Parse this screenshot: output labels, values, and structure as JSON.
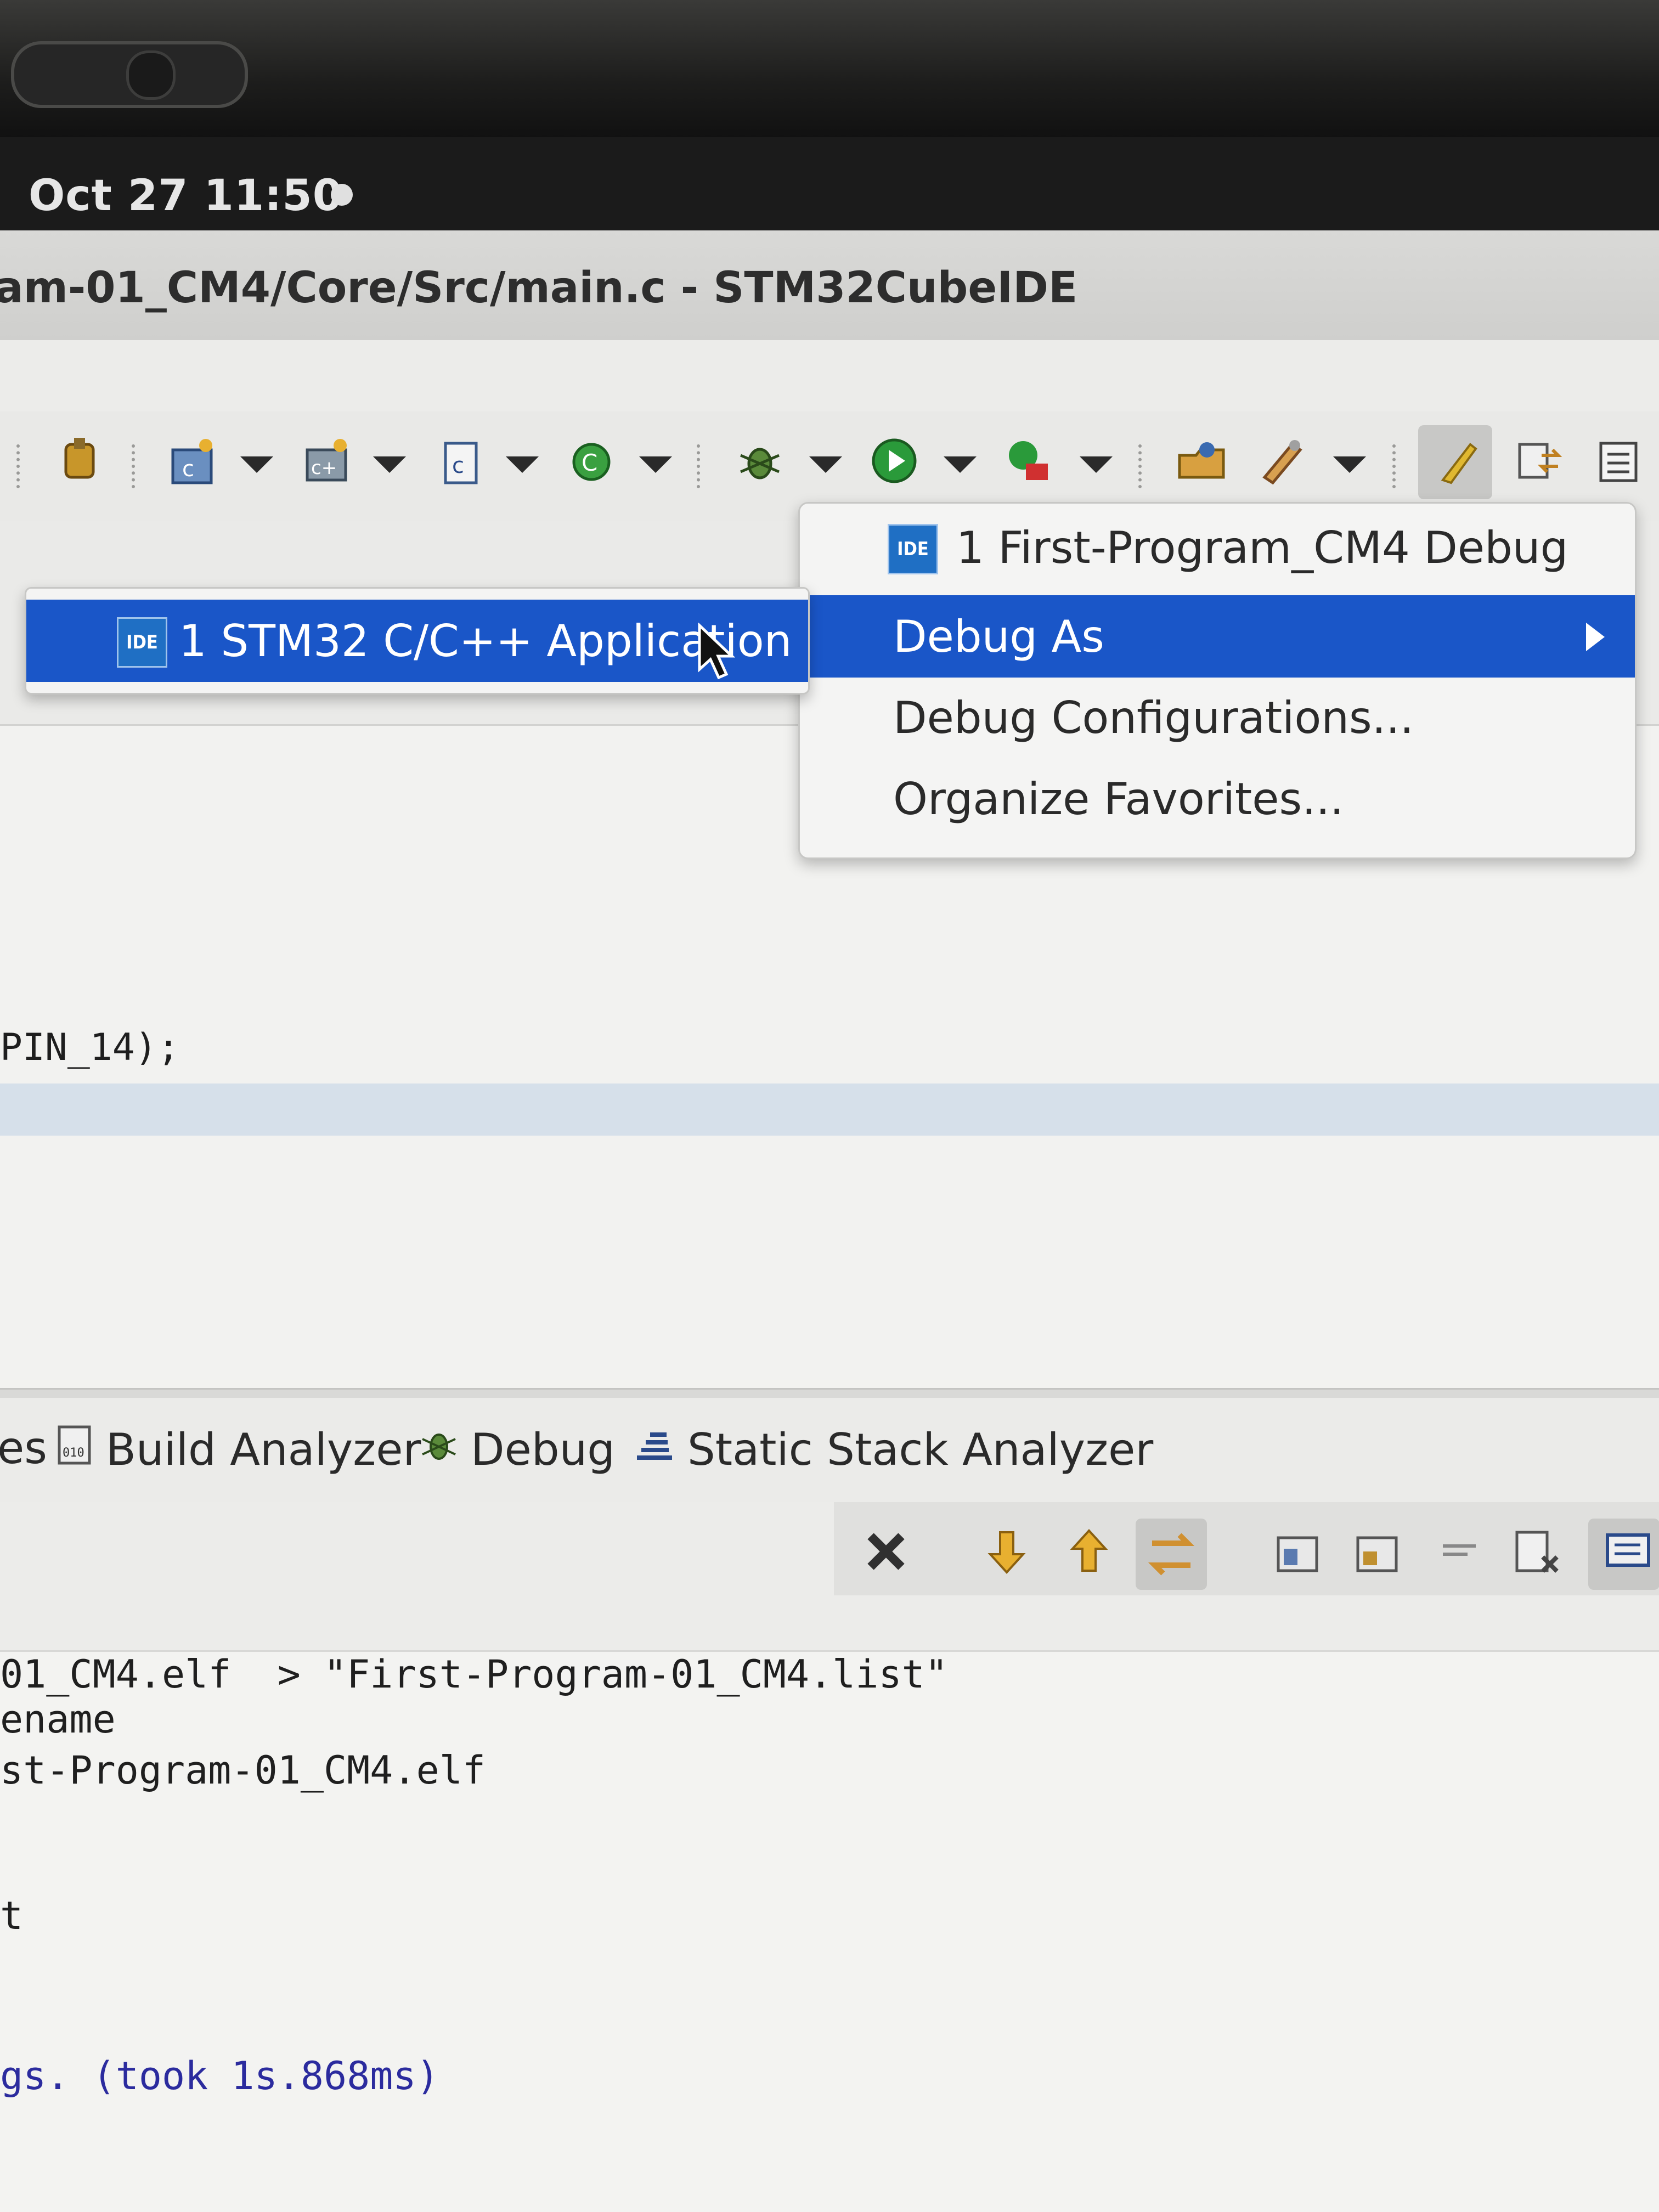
{
  "system": {
    "clock": "Oct 27  11:50"
  },
  "window": {
    "title": "am-01_CM4/Core/Src/main.c - STM32CubeIDE"
  },
  "toolbar": {
    "icons": [
      "debug-perspective-icon",
      "new-c-project-icon",
      "new-cpp-project-icon",
      "new-source-file-icon",
      "refresh-icon",
      "debug-bug-icon",
      "run-icon",
      "external-tools-icon",
      "open-folder-icon",
      "build-tools-icon",
      "highlight-icon",
      "toggle-icon",
      "console-view-icon"
    ]
  },
  "editor": {
    "visible_code": "PIN_14);"
  },
  "context_menu": {
    "items": [
      {
        "label": "1 First-Program_CM4 Debug",
        "badge": "IDE",
        "highlighted": false
      },
      {
        "label": "Debug As",
        "badge": "",
        "highlighted": true,
        "has_submenu": true
      },
      {
        "label": "Debug Configurations...",
        "badge": "",
        "highlighted": false
      },
      {
        "label": "Organize Favorites...",
        "badge": "",
        "highlighted": false
      }
    ]
  },
  "submenu": {
    "items": [
      {
        "label": "1 STM32 C/C++ Application",
        "badge": "IDE",
        "highlighted": true
      }
    ]
  },
  "bottom_panel": {
    "tabs": [
      {
        "label": "es"
      },
      {
        "label": "Build Analyzer",
        "icon": "build-analyzer-icon"
      },
      {
        "label": "Debug",
        "icon": "debug-bug-icon"
      },
      {
        "label": "Static Stack Analyzer",
        "icon": "stack-analyzer-icon"
      }
    ],
    "console_lines": [
      "01_CM4.elf  > \"First-Program-01_CM4.list\"",
      "ename",
      "st-Program-01_CM4.elf",
      "",
      "t",
      "",
      "",
      "gs. (took 1s.868ms)"
    ]
  },
  "colors": {
    "highlight": "#1a56c8",
    "badge": "#1f6fc4",
    "current_line": "#d6e0ea"
  }
}
